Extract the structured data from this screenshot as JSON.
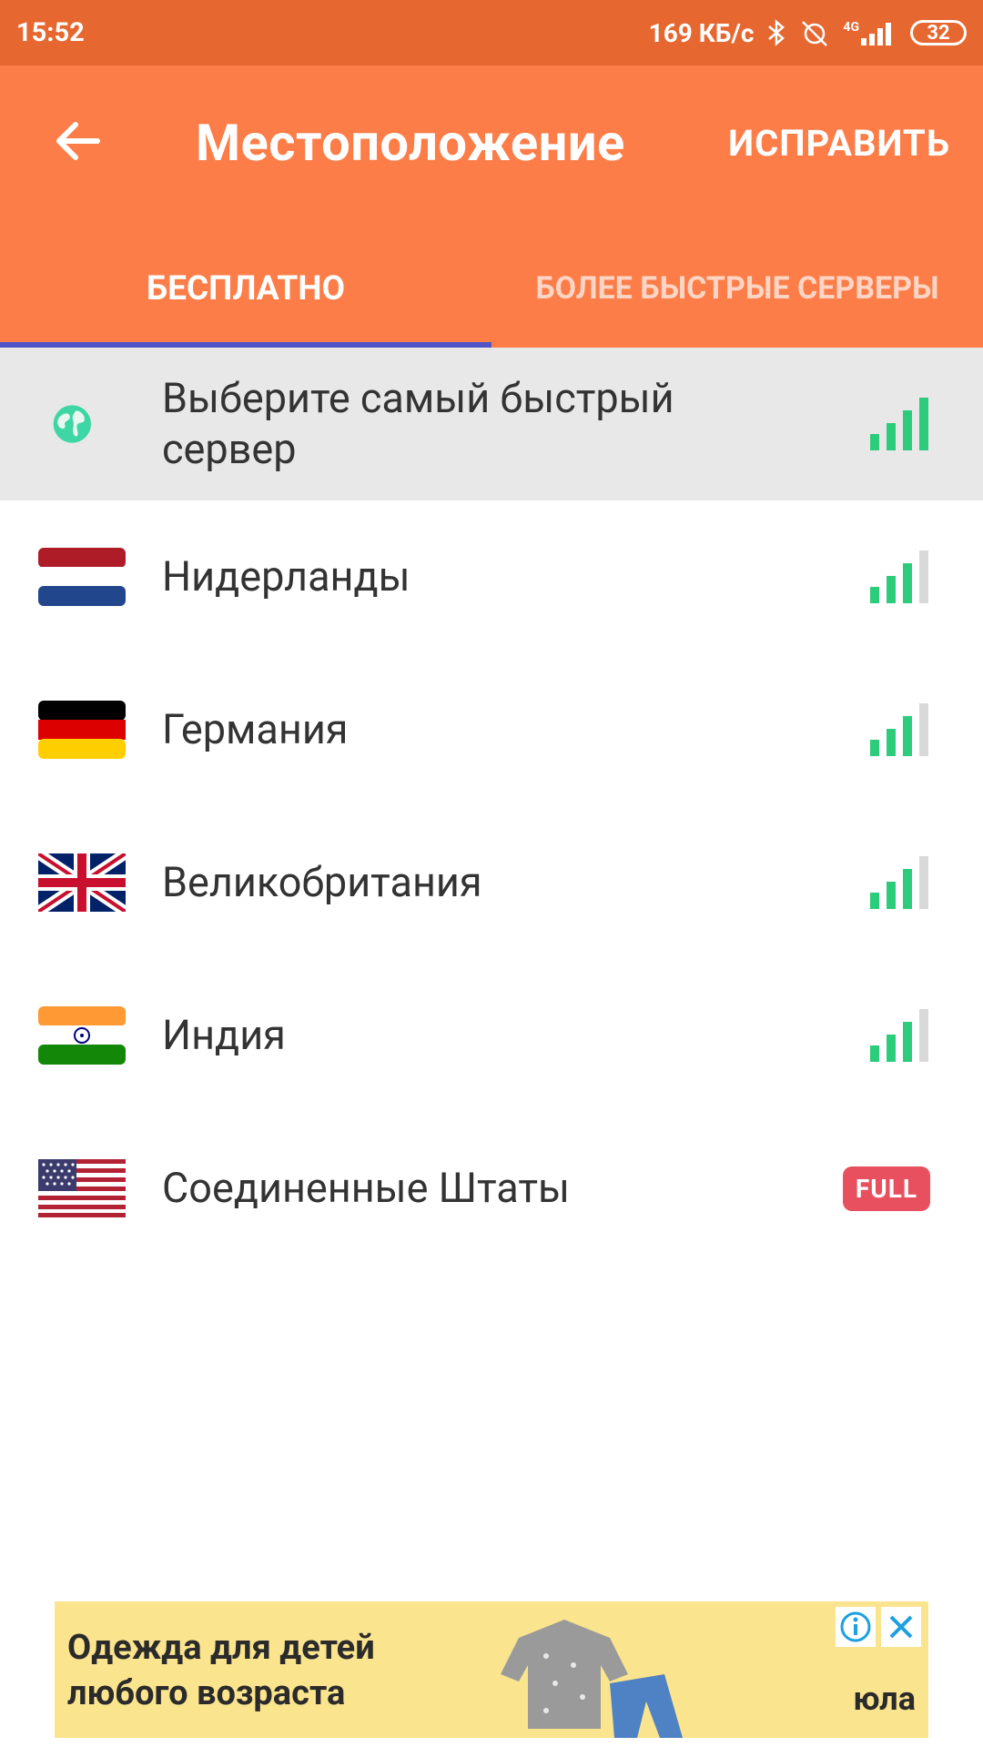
{
  "status_bar": {
    "time": "15:52",
    "network_speed": "169 КБ/с",
    "network_type": "4G",
    "battery": "32"
  },
  "app_bar": {
    "title": "Местоположение",
    "action_label": "ИСПРАВИТЬ",
    "tabs": [
      {
        "label": "БЕСПЛАТНО",
        "active": true
      },
      {
        "label": "БОЛЕЕ БЫСТРЫЕ СЕРВЕРЫ",
        "active": false
      }
    ]
  },
  "servers": [
    {
      "label": "Выберите самый быстрый сервер",
      "icon": "globe-icon",
      "signal_bars": 4,
      "status": null
    },
    {
      "label": "Нидерланды",
      "icon": "flag-netherlands-icon",
      "signal_bars": 3,
      "status": null
    },
    {
      "label": "Германия",
      "icon": "flag-germany-icon",
      "signal_bars": 3,
      "status": null
    },
    {
      "label": "Великобритания",
      "icon": "flag-uk-icon",
      "signal_bars": 3,
      "status": null
    },
    {
      "label": "Индия",
      "icon": "flag-india-icon",
      "signal_bars": 3,
      "status": null
    },
    {
      "label": "Соединенные Штаты",
      "icon": "flag-usa-icon",
      "signal_bars": null,
      "status": "FULL"
    }
  ],
  "ad": {
    "text_line1": "Одежда для детей",
    "text_line2": "любого возраста",
    "brand": "юла"
  },
  "colors": {
    "status_bar": "#E6672F",
    "app_bar": "#FC7D48",
    "tab_indicator": "#4F55C6",
    "signal_on": "#2DCB7C",
    "signal_off": "#D9D9D9",
    "full_badge": "#E8505F",
    "ad_background": "#FBE48E"
  }
}
